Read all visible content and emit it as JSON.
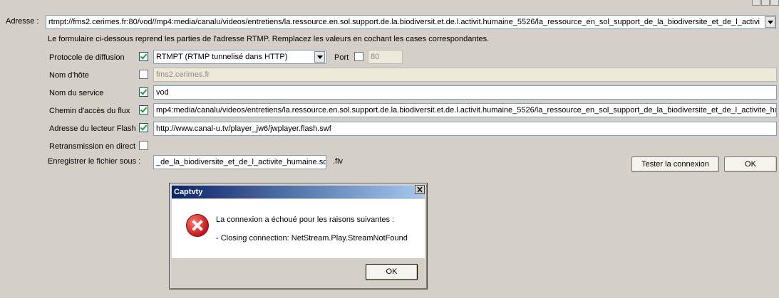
{
  "address": {
    "label": "Adresse :",
    "value": "rtmpt://fms2.cerimes.fr:80/vod//mp4:media/canalu/videos/entretiens/la.ressource.en.sol.support.de.la.biodiversit.et.de.l.activit.humaine_5526/la_ressource_en_sol_support_de_la_biodiversite_et_de_l_activi"
  },
  "instructions": "Le formulaire ci-dessous reprend les parties de l'adresse RTMP. Remplacez les valeurs en cochant les cases correspondantes.",
  "form": {
    "protocol": {
      "label": "Protocole de diffusion",
      "checked": true,
      "value": "RTMPT (RTMP tunnelisé dans HTTP)"
    },
    "port": {
      "label": "Port",
      "checked": false,
      "value": "80"
    },
    "hostname": {
      "label": "Nom d'hôte",
      "checked": false,
      "value": "fms2.cerimes.fr"
    },
    "service": {
      "label": "Nom du service",
      "checked": true,
      "value": "vod"
    },
    "path": {
      "label": "Chemin d'accès du flux",
      "checked": true,
      "value": "mp4:media/canalu/videos/entretiens/la.ressource.en.sol.support.de.la.biodiversit.et.de.l.activit.humaine_5526/la_ressource_en_sol_support_de_la_biodiversite_et_de_l_activite_hu"
    },
    "player": {
      "label": "Adresse du lecteur Flash",
      "checked": true,
      "value": "http://www.canal-u.tv/player_jw6/jwplayer.flash.swf"
    },
    "live": {
      "label": "Retransmission en direct",
      "checked": false
    },
    "save": {
      "label": "Enregistrer le fichier sous :",
      "value": "_de_la_biodiversite_et_de_l_activite_humaine.sd",
      "ext": ".flv"
    }
  },
  "buttons": {
    "test": "Tester la connexion",
    "ok": "OK"
  },
  "dialog": {
    "title": "Captvty",
    "message": "La connexion a échoué pour les raisons suivantes :",
    "detail": "- Closing connection: NetStream.Play.StreamNotFound",
    "ok": "OK",
    "icon": "error-icon",
    "close": "×"
  }
}
